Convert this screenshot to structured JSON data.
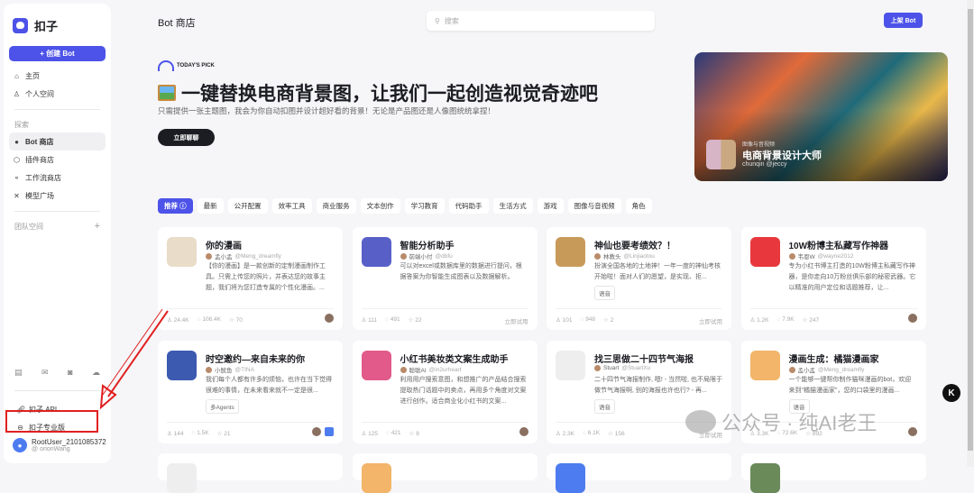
{
  "sidebar": {
    "logo": "扣子",
    "create": "+ 创建 Bot",
    "nav": [
      "主页",
      "个人空间"
    ],
    "explore_label": "探索",
    "explore": [
      "Bot 商店",
      "插件商店",
      "工作流商店",
      "模型广场"
    ],
    "team_label": "团队空间",
    "team_add": "+",
    "api": "扣子 API",
    "pro": "扣子专业版",
    "user": {
      "name": "RootUser_2101085372",
      "handle": "@ orionWang"
    }
  },
  "header": {
    "title": "Bot 商店",
    "search_placeholder": "搜索",
    "list_bot": "上架 Bot"
  },
  "hero": {
    "pick_label": "TODAY'S PICK",
    "title": "一键替换电商背景图，让我们一起创造视觉奇迹吧",
    "subtitle": "只需提供一张主题图，我会为你自动扣图并设计超好看的背景！无论是产品图还是人像图统统拿捏！",
    "cta": "立即聊聊",
    "card": {
      "category": "图像与音视频",
      "name": "电商背景设计大师",
      "author": "chunqin @jeccy"
    }
  },
  "tabs": [
    "推荐 ⓘ",
    "最新",
    "公开配置",
    "效率工具",
    "商业服务",
    "文本创作",
    "学习教育",
    "代码助手",
    "生活方式",
    "游戏",
    "图像与音视频",
    "角色"
  ],
  "try_label": "立即试用",
  "bots": [
    {
      "title": "你的漫画",
      "author": "孟小孟",
      "handle": "@Meng_dreamfly",
      "desc": "【你的漫画】是一款创新的定制漫画制作工具。只需上传您的照片，并表达您的故事主题，我们将为您打造专属的个性化漫画。...",
      "users": "24.4K",
      "chats": "108.4K",
      "stars": "70",
      "color": "#e9dcc8"
    },
    {
      "title": "智能分析助手",
      "author": "前端小付",
      "handle": "@dbfu",
      "desc": "可以对excel或数据库里的数据进行提问，根据答案为你智能生成图表以及数据解析。",
      "users": "111",
      "chats": "491",
      "stars": "22",
      "color": "#5860c8"
    },
    {
      "title": "神仙也要考绩效？！",
      "author": "林教头",
      "handle": "@Linjiaotou",
      "desc": "扮演全国各地的土地神！一年一度的神仙考核开始啦！面对人们的愿望，是实现、拒...",
      "tag": "语音",
      "users": "101",
      "chats": "948",
      "stars": "2",
      "color": "#c89a5a"
    },
    {
      "title": "10W粉博主私藏写作神器",
      "author": "韦恩W",
      "handle": "@wayne2012",
      "desc": "专为小红书博主打造的10W粉博主私藏写作神器，是你走向10万粉丝俱乐部的秘密武器。它以精准的用户定位和话题推荐，让...",
      "users": "1.2K",
      "chats": "7.9K",
      "stars": "247",
      "color": "#e8383d"
    },
    {
      "title": "时空邀约—来自未来的你",
      "author": "小鱿鱼",
      "handle": "@TINA",
      "desc": "我们每个人都有许多的烦恼，也许在当下觉得很难的事情，在未来看来就不一定是很...",
      "tag": "多Agents",
      "users": "144",
      "chats": "1.5K",
      "stars": "21",
      "color": "#3b5ab0"
    },
    {
      "title": "小红书美妆类文案生成助手",
      "author": "聪聪AI",
      "handle": "@in2urheart",
      "desc": "利用用户搜索意图，和想推广的产品结合搜索提取热门话题中的卖点，再用多个角度对文案进行创作。适合商业化小红书的文案...",
      "users": "125",
      "chats": "421",
      "stars": "8",
      "color": "#e25a8a"
    },
    {
      "title": "找三思做二十四节气海报",
      "author": "Stuart",
      "handle": "@StuartXu",
      "desc": "二十四节气海报制作, 嗯! - 当然啦, 也不局限于做节气海报啊, 别的海报也许也行? - 再...",
      "tag": "语音",
      "users": "2.3K",
      "chats": "6.1K",
      "stars": "156",
      "color": "#eeeeee"
    },
    {
      "title": "漫画生成：橘猫漫画家",
      "author": "孟小孟",
      "handle": "@Meng_dreamfly",
      "desc": "一个能够一键帮你制作猫咪漫画的bot，欢迎来到\"橘猫漫画家\"，您的口袋里的漫画...",
      "tag": "语音",
      "users": "3.3K",
      "chats": "72.6K",
      "stars": "892",
      "color": "#f2b56a"
    }
  ],
  "row3_colors": [
    "#eeeeee",
    "#f2b56a",
    "#4d7cf0",
    "#6a8a5a"
  ],
  "watermark": "公众号 · 纯AI老王",
  "k_button": "K"
}
